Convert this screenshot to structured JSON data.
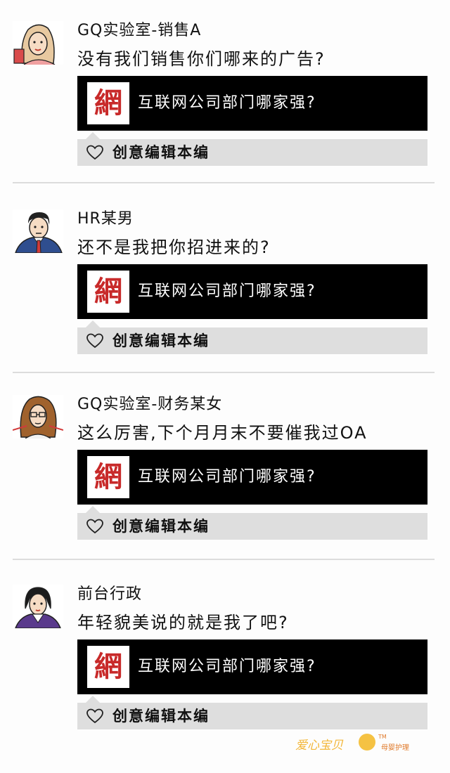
{
  "posts": [
    {
      "author": "GQ实验室-销售A",
      "text": "没有我们销售你们哪来的广告?",
      "card": {
        "logo_char": "網",
        "title": "互联网公司部门哪家强?"
      },
      "likes": {
        "names": "创意编辑本编"
      }
    },
    {
      "author": "HR某男",
      "text": "还不是我把你招进来的?",
      "card": {
        "logo_char": "網",
        "title": "互联网公司部门哪家强?"
      },
      "likes": {
        "names": "创意编辑本编"
      }
    },
    {
      "author": "GQ实验室-财务某女",
      "text": "这么厉害,下个月月末不要催我过OA",
      "card": {
        "logo_char": "網",
        "title": "互联网公司部门哪家强?"
      },
      "likes": {
        "names": "创意编辑本编"
      }
    },
    {
      "author": "前台行政",
      "text": "年轻貌美说的就是我了吧?",
      "card": {
        "logo_char": "網",
        "title": "互联网公司部门哪家强?"
      },
      "likes": {
        "names": "创意编辑本编"
      }
    }
  ],
  "watermark": {
    "brand": "爱心宝贝",
    "tm": "TM",
    "sub": "母婴护理"
  },
  "colors": {
    "card_bg": "#000000",
    "logo_red": "#c82a2a",
    "like_bar": "#dedede",
    "watermark": "#f3b73b"
  },
  "icons": {
    "like": "heart-outline-icon"
  }
}
